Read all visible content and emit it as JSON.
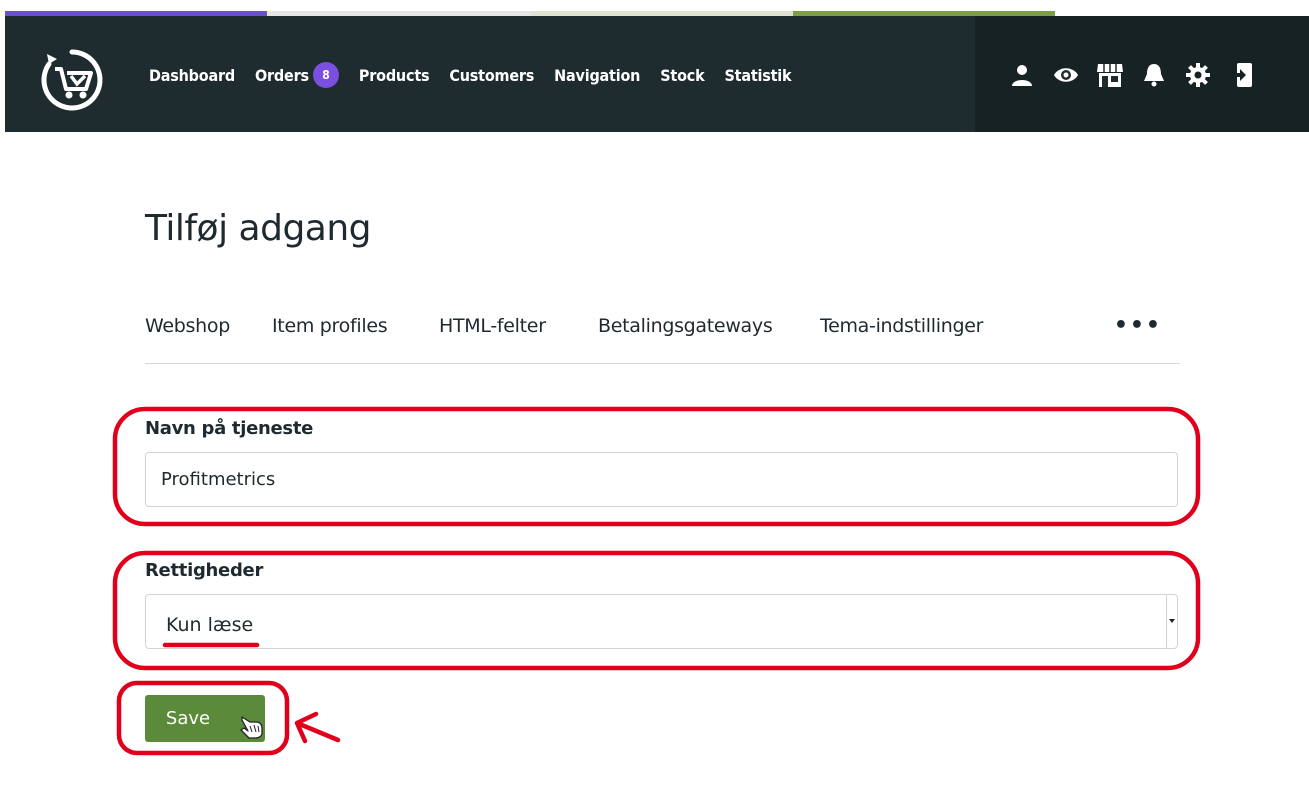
{
  "colors": {
    "navbar": "#1e2b2f",
    "navbar_right": "#172225",
    "badge": "#7b4fe0",
    "save_button": "#5a8a3a",
    "annotation": "#e0001b",
    "strip": [
      "#6b4fd6",
      "#e6e6e6",
      "#dfe4d2",
      "#7e9e48",
      "#ffffff"
    ]
  },
  "nav": {
    "items": [
      {
        "label": "Dashboard"
      },
      {
        "label": "Orders",
        "badge": "8"
      },
      {
        "label": "Products"
      },
      {
        "label": "Customers"
      },
      {
        "label": "Navigation"
      },
      {
        "label": "Stock"
      },
      {
        "label": "Statistik"
      }
    ],
    "icons": [
      "user-icon",
      "eye-icon",
      "store-icon",
      "bell-icon",
      "gear-icon",
      "logout-icon"
    ]
  },
  "page": {
    "title": "Tilføj adgang",
    "tabs": [
      "Webshop",
      "Item profiles",
      "HTML-felter",
      "Betalingsgateways",
      "Tema-indstillinger"
    ],
    "more": "•••"
  },
  "form": {
    "service_label": "Navn på tjeneste",
    "service_value": "Profitmetrics",
    "rights_label": "Rettigheder",
    "rights_value": "Kun læse",
    "save_label": "Save"
  }
}
